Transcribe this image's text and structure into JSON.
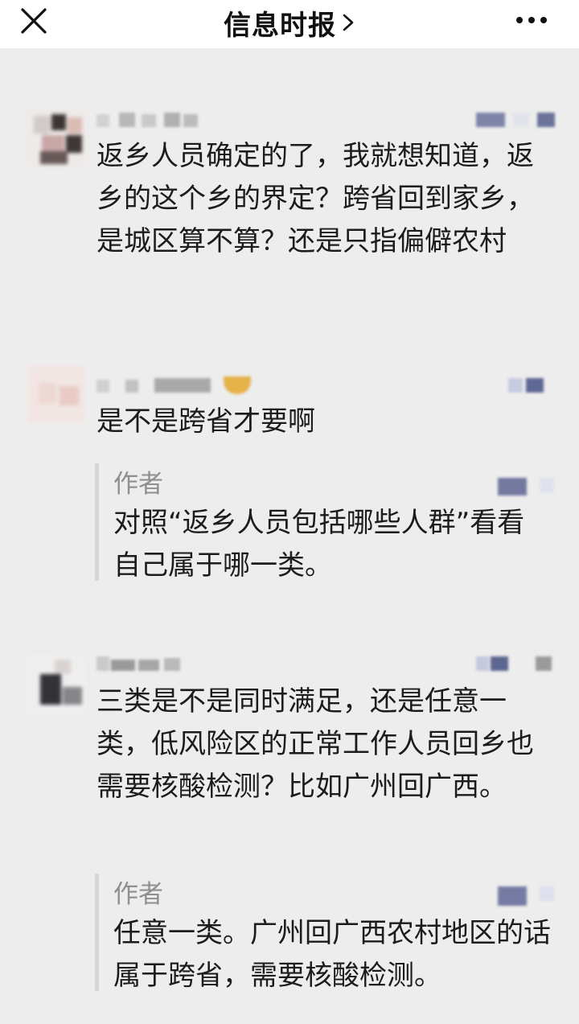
{
  "header": {
    "title": "信息时报",
    "close_icon": "close-icon",
    "more_icon": "more-icon",
    "chevron_icon": "chevron-right-icon"
  },
  "comments": [
    {
      "text": "返乡人员确定的了，我就想知道，返乡的这个乡的界定？跨省回到家乡，是城区算不算？还是只指偏僻农村"
    },
    {
      "text": "是不是跨省才要啊",
      "reply": {
        "author": "作者",
        "text": "对照“返乡人员包括哪些人群”看看自己属于哪一类。"
      }
    },
    {
      "text": "三类是不是同时满足，还是任意一类，低风险区的正常工作人员回乡也需要核酸检测？比如广州回广西。",
      "reply": {
        "author": "作者",
        "text": "任意一类。广州回广西农村地区的话属于跨省，需要核酸检测。"
      }
    }
  ]
}
